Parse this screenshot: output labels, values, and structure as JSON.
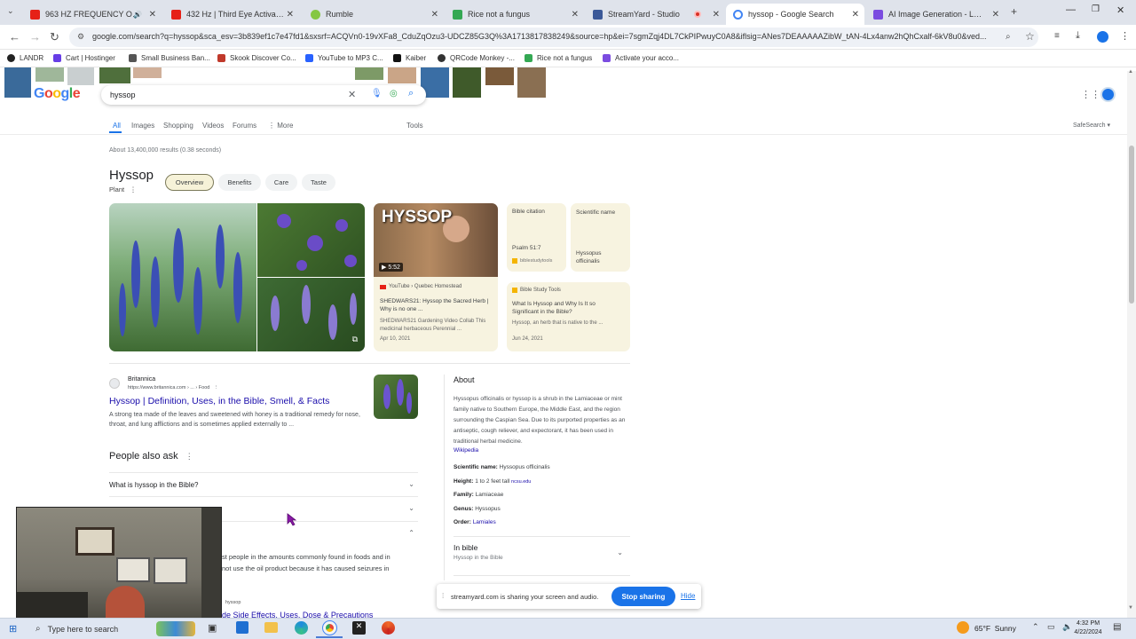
{
  "browser": {
    "tabs": [
      {
        "title": "963 HZ FREQUENCY OF G",
        "color": "#e62117",
        "active": false
      },
      {
        "title": "432 Hz | Third Eye Activation",
        "color": "#e62117",
        "active": false
      },
      {
        "title": "Rumble",
        "color": "#85c742",
        "active": false
      },
      {
        "title": "Rice not a fungus",
        "color": "#34a853",
        "active": false
      },
      {
        "title": "StreamYard - Studio",
        "color": "#3b5998",
        "active": false
      },
      {
        "title": "hyssop - Google Search",
        "color": "#4285f4",
        "active": true
      },
      {
        "title": "AI Image Generation - Leona",
        "color": "#7b4ce0",
        "active": false
      }
    ],
    "url": "google.com/search?q=hyssop&sca_esv=3b839ef1c7e47fd1&sxsrf=ACQVn0-19vXFa8_CduZqOzu3-UDCZ85G3Q%3A1713817838249&source=hp&ei=7sgmZqj4DL7CkPIPwuyC0A8&iflsig=ANes7DEAAAAAZibW_tAN-4Lx4anw2hQhCxalf-6kV8u0&ved...",
    "bookmarks": [
      {
        "label": "LANDR",
        "color": "#222"
      },
      {
        "label": "Cart | Hostinger",
        "color": "#673de6"
      },
      {
        "label": "Small Business Ban...",
        "color": "#555"
      },
      {
        "label": "Skook Discover Co...",
        "color": "#c0392b"
      },
      {
        "label": "YouTube to MP3 C...",
        "color": "#2962ff"
      },
      {
        "label": "Kaiber",
        "color": "#111"
      },
      {
        "label": "QRCode Monkey -...",
        "color": "#333"
      },
      {
        "label": "Rice not a fungus",
        "color": "#34a853"
      },
      {
        "label": "Activate your acco...",
        "color": "#7b4ce0"
      }
    ]
  },
  "google": {
    "logo": "Google",
    "query": "hyssop",
    "tabs": [
      "All",
      "Images",
      "Shopping",
      "Videos",
      "Forums",
      "More"
    ],
    "tools": "Tools",
    "safesearch": "SafeSearch",
    "result_count": "About 13,400,000 results (0.38 seconds)"
  },
  "knowledge": {
    "title": "Hyssop",
    "subtitle": "Plant",
    "chips": [
      "Overview",
      "Benefits",
      "Care",
      "Taste"
    ],
    "video_overlay": "HYSSOP",
    "video_duration": "5:52",
    "video_source": "YouTube › Quebec Homestead",
    "video_title": "SHEDWARS21: Hyssop the Sacred Herb | Why is no one ...",
    "video_desc": "SHEDWARS21 Gardening Video Collab This medicinal herbaceous Perennial ...",
    "video_date": "Apr 10, 2021",
    "bible_label": "Bible citation",
    "bible_value": "Psalm 51:7",
    "bible_source": "biblestudytools",
    "sci_label": "Scientific name",
    "sci_value": "Hyssopus officinalis",
    "study_source": "Bible Study Tools",
    "study_title": "What Is Hyssop and Why Is It so Significant in the Bible?",
    "study_desc": "Hyssop, an herb that is native to the ...",
    "study_date": "Jun 24, 2021"
  },
  "result": {
    "site": "Britannica",
    "url": "https://www.britannica.com › ... › Food",
    "title": "Hyssop | Definition, Uses, in the Bible, Smell, & Facts",
    "snippet": "A strong tea made of the leaves and sweetened with honey is a traditional remedy for nose, throat, and lung afflictions and is sometimes applied externally to ..."
  },
  "paa": {
    "heading": "People also ask",
    "questions": [
      "What is hyssop in the Bible?"
    ],
    "partial_text_1": "st people in the amounts commonly found in foods and in",
    "partial_text_2": "not use the oil product because it has caused seizures in",
    "partial_link": "de Side Effects, Uses, Dose & Precautions",
    "partial_small": "hyssop"
  },
  "about": {
    "heading": "About",
    "text": "Hyssopus officinalis or hyssop is a shrub in the Lamiaceae or mint family native to Southern Europe, the Middle East, and the region surrounding the Caspian Sea. Due to its purported properties as an antiseptic, cough reliever, and expectorant, it has been used in traditional herbal medicine.",
    "source": "Wikipedia",
    "facts": [
      {
        "key": "Scientific name:",
        "value": "Hyssopus officinalis",
        "extra": ""
      },
      {
        "key": "Height:",
        "value": "1 to 2 feet tall",
        "extra": "ncsu.edu"
      },
      {
        "key": "Family:",
        "value": "Lamiaceae",
        "extra": ""
      },
      {
        "key": "Genus:",
        "value": "Hyssopus",
        "extra": ""
      },
      {
        "key": "Order:",
        "value": "",
        "extra": "Lamiales"
      }
    ],
    "in_bible": "In bible",
    "in_bible_sub": "Hyssop in the Bible"
  },
  "share_banner": {
    "text": "streamyard.com is sharing your screen and audio.",
    "stop": "Stop sharing",
    "hide": "Hide"
  },
  "taskbar": {
    "search": "Type here to search",
    "weather": "65°F  Sunny",
    "time": "4:32 PM",
    "date": "4/22/2024"
  }
}
